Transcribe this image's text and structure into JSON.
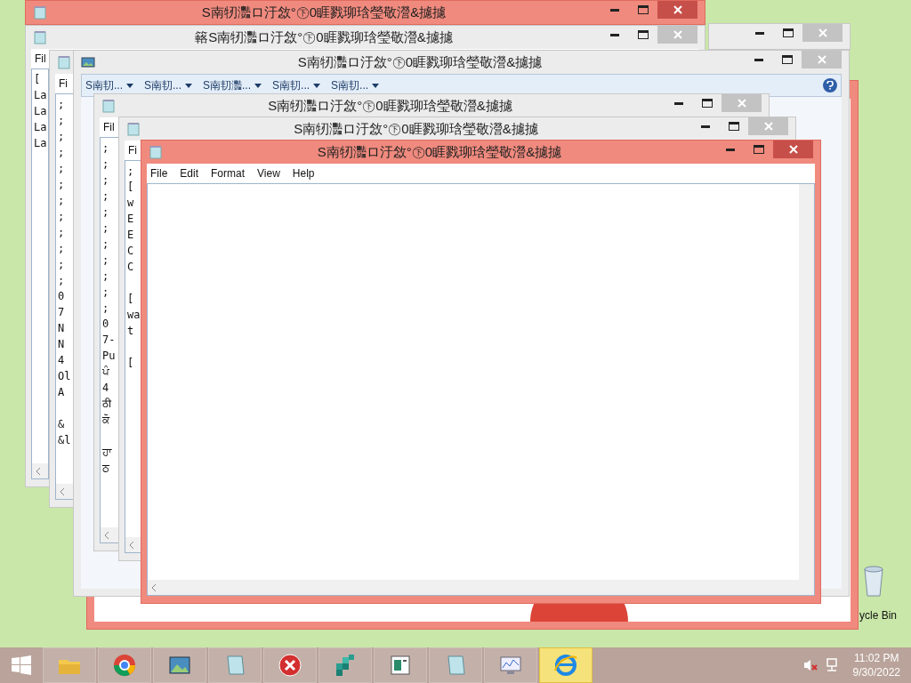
{
  "desktop": {
    "recycle_bin_label": "ycle Bin"
  },
  "windows": [
    {
      "kind": "frame",
      "highlighted": true
    },
    {
      "kind": "titlebar",
      "highlighted": false
    },
    {
      "kind": "notepad",
      "title": "S南牣灩ロ汙敜°㊦0睚戮珋琀瑩敬瀯&攄攄",
      "highlighted": true
    },
    {
      "kind": "notepad",
      "title": "簵S南牣灩ロ汙敜°㊦0睚戮珋琀瑩敬瀯&攄攄",
      "highlighted": false,
      "menu": [
        "Fil"
      ],
      "blocks": [
        [
          "[",
          "La",
          "La",
          "La",
          "La"
        ]
      ]
    },
    {
      "kind": "notepad",
      "highlighted": false,
      "menu": [
        "Fi"
      ],
      "blocks": [
        [
          ";",
          ";",
          ";",
          ";",
          ";",
          ";",
          ";",
          ";",
          ";",
          ";",
          ";",
          ";",
          "0",
          "7",
          "N",
          "N",
          "4",
          "Ol",
          "A"
        ],
        [
          "&",
          "&l"
        ]
      ]
    },
    {
      "kind": "viewer",
      "title": "S南牣灩ロ汙敜°㊦0睚戮珋琀瑩敬瀯&攄攄",
      "highlighted": false,
      "toolbar": [
        "S南㓞...",
        "S南㓞...",
        "S南㓞灩...",
        "S南㓞...",
        "S南㓞..."
      ]
    },
    {
      "kind": "notepad",
      "title": "S南牣灩ロ汙敜°㊦0睚戮珋琀瑩敬瀯&攄攄",
      "highlighted": false,
      "menu": [
        "Fil"
      ],
      "blocks": [
        [
          ";",
          ";",
          ";",
          ";",
          ";",
          ";",
          ";",
          ";",
          ";",
          ";",
          ";",
          "0",
          "7-",
          "Pu",
          "ਪੰ",
          "4",
          "ठी",
          "ਕੋ"
        ],
        [
          "ਹਾ",
          "ਠ"
        ]
      ]
    },
    {
      "kind": "notepad",
      "title": "S南牣灩ロ汙敜°㊦0睚戮珋琀瑩敬瀯&攄攄",
      "highlighted": false,
      "menu": [
        "Fi"
      ],
      "blocks": [
        [
          ";",
          "[",
          "w",
          "E",
          "E",
          "C",
          "C"
        ],
        [
          "[",
          "wa",
          "t"
        ],
        [
          "["
        ]
      ]
    },
    {
      "kind": "notepad",
      "title": "S南牣灩ロ汙敜°㊦0睚戮珋琀瑩敬瀯&攄攄",
      "highlighted": true,
      "menu": [
        "File",
        "Edit",
        "Format",
        "View",
        "Help"
      ]
    }
  ],
  "taskbar": {
    "items": [
      {
        "kind": "folder",
        "selected": false
      },
      {
        "kind": "chrome",
        "selected": false
      },
      {
        "kind": "photo",
        "selected": false
      },
      {
        "kind": "notepad",
        "selected": false
      },
      {
        "kind": "error",
        "selected": false
      },
      {
        "kind": "cubes",
        "selected": false
      },
      {
        "kind": "reader",
        "selected": false
      },
      {
        "kind": "notepad",
        "selected": false
      },
      {
        "kind": "monitor",
        "selected": false
      },
      {
        "kind": "ie",
        "selected": true
      }
    ],
    "time": "11:02 PM",
    "date": "9/30/2022"
  }
}
